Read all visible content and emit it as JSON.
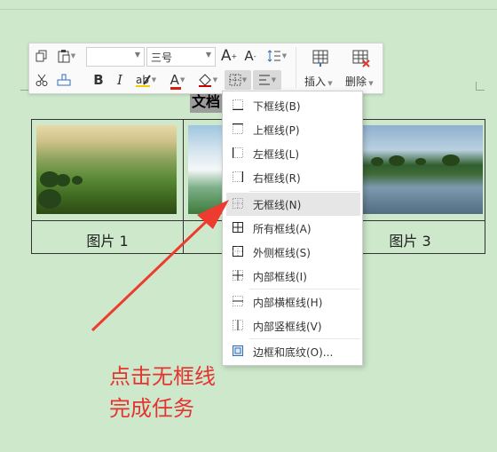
{
  "toolbar": {
    "font_name": "",
    "font_size": "三号",
    "insert_label": "插入",
    "delete_label": "删除",
    "bold": "B",
    "italic": "I",
    "font_grow": "A",
    "font_shrink": "A",
    "font_color": "A"
  },
  "document": {
    "title": "文档",
    "captions": [
      "图片 1",
      "图片 3"
    ]
  },
  "menu": {
    "items": [
      {
        "label": "下框线(B)"
      },
      {
        "label": "上框线(P)"
      },
      {
        "label": "左框线(L)"
      },
      {
        "label": "右框线(R)"
      },
      {
        "label": "无框线(N)"
      },
      {
        "label": "所有框线(A)"
      },
      {
        "label": "外侧框线(S)"
      },
      {
        "label": "内部框线(I)"
      },
      {
        "label": "内部横框线(H)"
      },
      {
        "label": "内部竖框线(V)"
      },
      {
        "label": "边框和底纹(O)..."
      }
    ]
  },
  "annotation": {
    "line1": "点击无框线",
    "line2": "完成任务",
    "color": "#e53430"
  }
}
